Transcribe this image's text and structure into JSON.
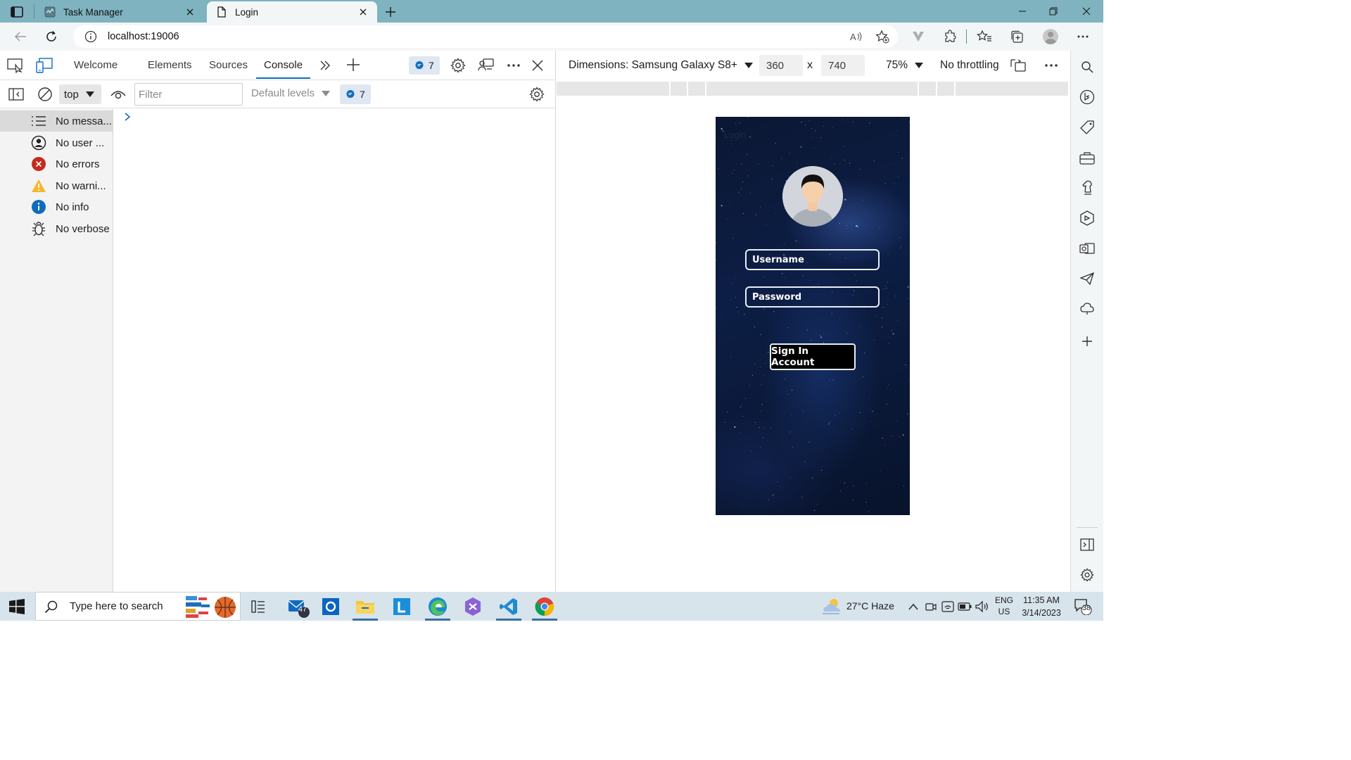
{
  "browser": {
    "tabs": [
      {
        "label": "Task Manager",
        "active": false
      },
      {
        "label": "Login",
        "active": true
      }
    ],
    "address": "localhost:19006"
  },
  "devtools": {
    "tabs": [
      "Welcome",
      "Elements",
      "Sources",
      "Console"
    ],
    "active_tab": "Console",
    "issues_count": "7",
    "context": "top",
    "filter_placeholder": "Filter",
    "levels": "Default levels",
    "messages_count": "7",
    "sidebar": [
      {
        "label": "No messa...",
        "icon": "list-icon",
        "selected": true
      },
      {
        "label": "No user ...",
        "icon": "user-icon",
        "selected": false
      },
      {
        "label": "No errors",
        "icon": "error-icon",
        "color": "#c42b1c",
        "selected": false
      },
      {
        "label": "No warni...",
        "icon": "warning-icon",
        "color": "#f7b529",
        "selected": false
      },
      {
        "label": "No info",
        "icon": "info-icon",
        "color": "#0f6cbd",
        "selected": false
      },
      {
        "label": "No verbose",
        "icon": "bug-icon",
        "selected": false
      }
    ]
  },
  "device_toolbar": {
    "dimensions": "Dimensions: Samsung Galaxy S8+",
    "width": "360",
    "times": "x",
    "height": "740",
    "zoom": "75%",
    "throttling": "No throttling"
  },
  "app": {
    "title": "Login",
    "username_placeholder": "Username",
    "password_placeholder": "Password",
    "sign_in": "Sign In Account"
  },
  "taskbar": {
    "search_placeholder": "Type here to search",
    "mail_badge": "47",
    "weather": "27°C  Haze",
    "lang_top": "ENG",
    "lang_bottom": "US",
    "time": "11:35 AM",
    "date": "3/14/2023",
    "notifications": "38"
  },
  "colors": {
    "tab_strip": "#7fb3c0",
    "accent": "#0f6cbd",
    "error": "#c42b1c",
    "warning": "#f7b529"
  }
}
